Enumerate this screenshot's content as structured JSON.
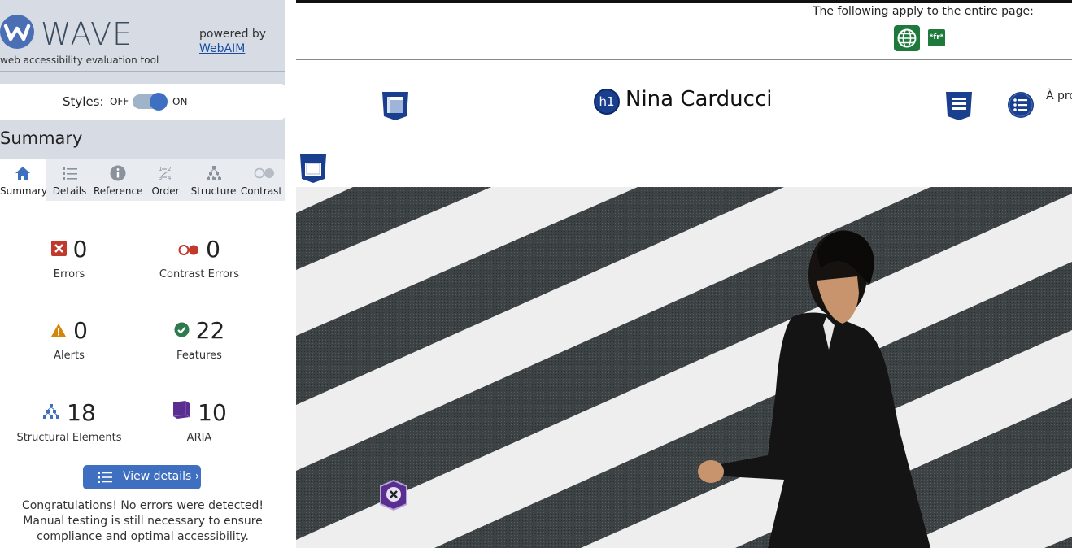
{
  "sidebar": {
    "brand": "WAVE",
    "tagline": "web accessibility evaluation tool",
    "powered_by": "powered by",
    "webaim_link": "WebAIM",
    "styles": {
      "label": "Styles:",
      "off": "OFF",
      "on": "ON",
      "state": "on"
    },
    "summary_heading": "Summary",
    "tabs": [
      {
        "label": "Summary",
        "icon": "home-icon",
        "active": true
      },
      {
        "label": "Details",
        "icon": "list-icon",
        "active": false
      },
      {
        "label": "Reference",
        "icon": "info-icon",
        "active": false
      },
      {
        "label": "Order",
        "icon": "order-icon",
        "active": false
      },
      {
        "label": "Structure",
        "icon": "structure-icon",
        "active": false
      },
      {
        "label": "Contrast",
        "icon": "contrast-icon",
        "active": false
      }
    ],
    "stats": {
      "errors": {
        "value": "0",
        "label": "Errors"
      },
      "contrast_errors": {
        "value": "0",
        "label": "Contrast Errors"
      },
      "alerts": {
        "value": "0",
        "label": "Alerts"
      },
      "features": {
        "value": "22",
        "label": "Features"
      },
      "structural": {
        "value": "18",
        "label": "Structural Elements"
      },
      "aria": {
        "value": "10",
        "label": "ARIA"
      }
    },
    "view_details": "View details ›",
    "congrats": "Congratulations! No errors were detected! Manual testing is still necessary to ensure compliance and optimal accessibility."
  },
  "page": {
    "apply_text": "The following apply to the entire page:",
    "fr_badge": "*fr*",
    "h1_badge": "h1",
    "site_title": "Nina Carducci",
    "nav_link": "À propos"
  },
  "colors": {
    "wave_blue": "#3e6fc0",
    "error_red": "#c0392b",
    "alert_orange": "#d4850b",
    "feature_green": "#1e7a3b",
    "structure_blue": "#1a3f8f",
    "aria_purple": "#5a2d91"
  }
}
